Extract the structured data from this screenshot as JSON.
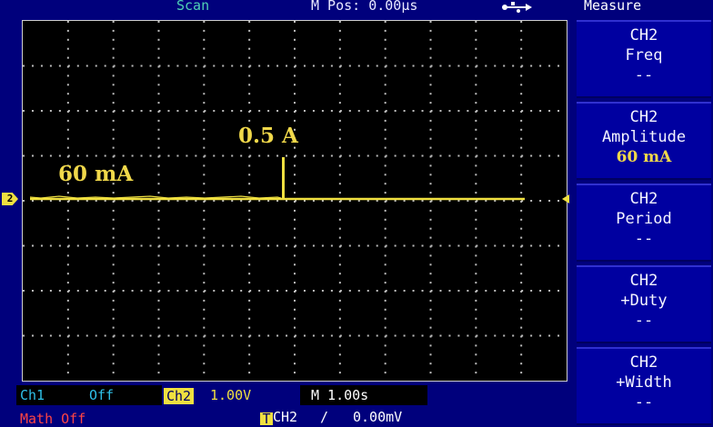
{
  "status_bar": {
    "mode": "Scan",
    "m_pos": "M Pos: 0.00µs",
    "usb_icon": "usb-icon"
  },
  "annotations": {
    "peak_label": "0.5 A",
    "baseline_label": "60 mA"
  },
  "channel_marker": "2",
  "measure_menu": {
    "title": "Measure",
    "items": [
      {
        "channel": "CH2",
        "name": "Freq",
        "value": "--"
      },
      {
        "channel": "CH2",
        "name": "Amplitude",
        "value": "60 mA"
      },
      {
        "channel": "CH2",
        "name": "Period",
        "value": "--"
      },
      {
        "channel": "CH2",
        "name": "+Duty",
        "value": "--"
      },
      {
        "channel": "CH2",
        "name": "+Width",
        "value": "--"
      }
    ]
  },
  "bottom_bar": {
    "ch1_label": "Ch1",
    "ch1_state": "Off",
    "ch2_label": "Ch2",
    "ch2_scale": "1.00V",
    "timebase": "M 1.00s",
    "math": "Math Off",
    "trigger_tag": "T",
    "trigger_source": "CH2",
    "trigger_slope": "/",
    "trigger_level": "0.00mV"
  },
  "colors": {
    "background": "#00007c",
    "trace": "#f0e040",
    "ch1": "#2fc0e8",
    "annotation": "#f0d84a"
  }
}
